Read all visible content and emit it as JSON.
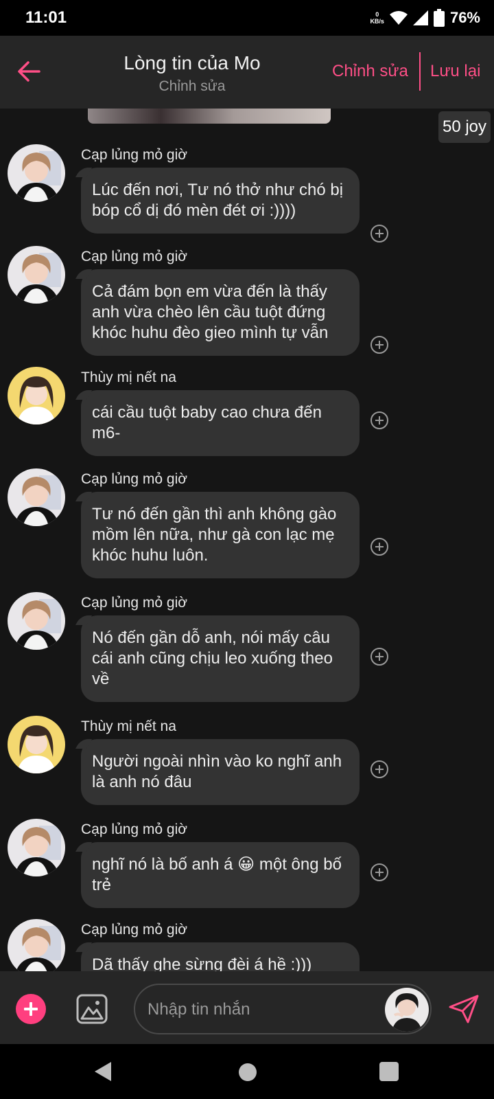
{
  "status_bar": {
    "time": "11:01",
    "speed_value": "0",
    "speed_unit": "KB/s",
    "battery": "76%"
  },
  "header": {
    "title": "Lòng tin của Mo",
    "subtitle": "Chỉnh sửa",
    "edit_label": "Chỉnh sửa",
    "save_label": "Lưu lại",
    "accent_color": "#ff4f87"
  },
  "joy_badge": "50 joy",
  "messages": [
    {
      "sender": "Cạp lủng mỏ giờ",
      "text": "Lúc đến nơi, Tư nó thở như chó bị bóp cổ dị đó mèn đét ơi :))))",
      "avatar": "avatar-1"
    },
    {
      "sender": "Cạp lủng mỏ giờ",
      "text": "Cả đám bọn em vừa đến là thấy anh vừa chèo lên cầu tuột đứng khóc huhu đèo gieo mình tự vẫn",
      "avatar": "avatar-1"
    },
    {
      "sender": "Thùy mị nết na",
      "text": "cái cầu tuột baby cao chưa đến m6-",
      "avatar": "avatar-2"
    },
    {
      "sender": "Cạp lủng mỏ giờ",
      "text": "Tư nó đến gần thì anh không gào mồm lên nữa, như gà con lạc mẹ khóc huhu luôn.",
      "avatar": "avatar-1"
    },
    {
      "sender": "Cạp lủng mỏ giờ",
      "text": "Nó đến gần dỗ anh, nói mấy câu cái anh cũng chịu leo xuống theo về",
      "avatar": "avatar-1"
    },
    {
      "sender": "Thùy mị nết na",
      "text": "Người ngoài nhìn vào ko nghĩ anh là anh nó đâu",
      "avatar": "avatar-2"
    },
    {
      "sender": "Cạp lủng mỏ giờ",
      "text": "nghĩ nó là bố anh á 😀 một ông bố trẻ",
      "avatar": "avatar-1"
    },
    {
      "sender": "Cạp lủng mỏ giờ",
      "text": "Dã thấy ghe sừng đèi á hề :)))",
      "avatar": "avatar-1"
    }
  ],
  "composer": {
    "placeholder": "Nhập tin nhắn"
  },
  "icons": {
    "back": "arrow-left-icon",
    "add": "plus-circle-icon",
    "image": "image-icon",
    "send": "send-icon"
  }
}
